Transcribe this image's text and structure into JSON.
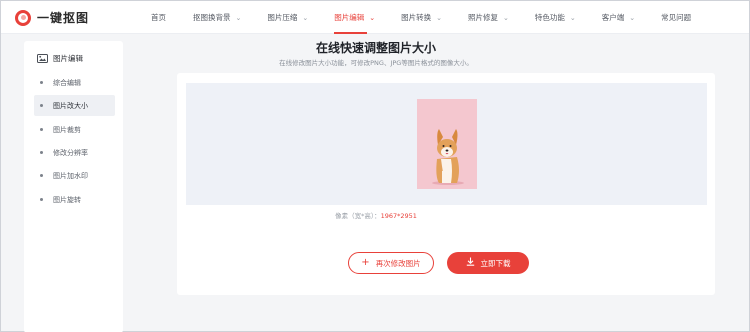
{
  "app": {
    "name": "一键抠图"
  },
  "nav": {
    "items": [
      {
        "label": "首页",
        "chevron": false
      },
      {
        "label": "抠图换背景",
        "chevron": true
      },
      {
        "label": "图片压缩",
        "chevron": true
      },
      {
        "label": "图片编辑",
        "chevron": true,
        "active": true
      },
      {
        "label": "图片转换",
        "chevron": true
      },
      {
        "label": "照片修复",
        "chevron": true
      },
      {
        "label": "特色功能",
        "chevron": true
      },
      {
        "label": "客户端",
        "chevron": true
      },
      {
        "label": "常见问题",
        "chevron": false
      }
    ]
  },
  "sidebar": {
    "heading": "图片编辑",
    "items": [
      {
        "label": "综合编辑"
      },
      {
        "label": "图片改大小",
        "active": true
      },
      {
        "label": "图片裁剪"
      },
      {
        "label": "修改分辨率"
      },
      {
        "label": "图片加水印"
      },
      {
        "label": "图片旋转"
      }
    ]
  },
  "main": {
    "title": "在线快速调整图片大小",
    "subtitle": "在线修改图片大小功能，可修改PNG、JPG等图片格式的图像大小。",
    "meta_label": "像素（宽*高）：",
    "meta_value": "1967*2951"
  },
  "actions": {
    "redo_label": "再次修改图片",
    "download_label": "立即下载"
  },
  "colors": {
    "accent": "#e8413a",
    "preview_bg": "#eef1f7",
    "photo_bg": "#f4c7cf"
  }
}
